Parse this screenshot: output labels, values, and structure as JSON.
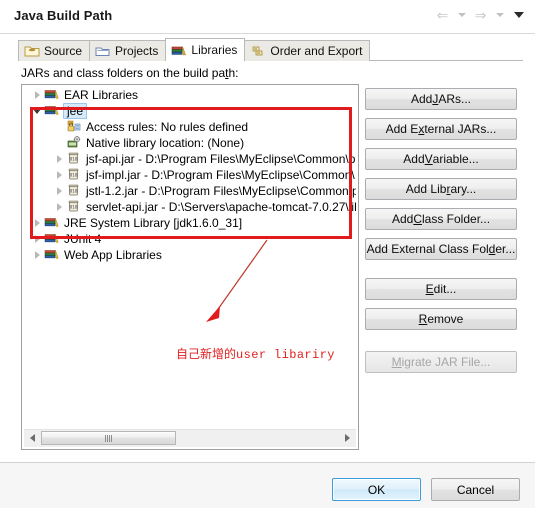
{
  "window": {
    "title": "Java Build Path",
    "nav": [
      {
        "name": "back-arrow-icon",
        "glyph": "⇐"
      },
      {
        "name": "back-dropdown-icon",
        "glyph": "▾"
      },
      {
        "name": "forward-arrow-icon",
        "glyph": "⇒"
      },
      {
        "name": "forward-dropdown-icon",
        "glyph": "▾"
      },
      {
        "name": "menu-dropdown-icon",
        "glyph": "▾"
      }
    ]
  },
  "tabs": [
    {
      "label": "Source",
      "icon": "source-folder-icon",
      "active": false
    },
    {
      "label": "Projects",
      "icon": "projects-folder-icon",
      "active": false
    },
    {
      "label": "Libraries",
      "icon": "libraries-books-icon",
      "active": true
    },
    {
      "label": "Order and Export",
      "icon": "order-export-icon",
      "active": false
    }
  ],
  "main": {
    "section_label_pre": "JARs and class folders on the build pa",
    "section_label_mnemonic": "t",
    "section_label_post": "h:",
    "tree": [
      {
        "label": "EAR Libraries",
        "icon": "library-books-icon",
        "indent": 0,
        "twisty": "closed",
        "selected": false
      },
      {
        "label": "jee",
        "icon": "library-books-icon",
        "indent": 0,
        "twisty": "open",
        "selected": true
      },
      {
        "label": "Access rules: No rules defined",
        "icon": "access-rules-icon",
        "indent": 1,
        "twisty": "none",
        "selected": false
      },
      {
        "label": "Native library location: (None)",
        "icon": "native-library-icon",
        "indent": 1,
        "twisty": "none",
        "selected": false
      },
      {
        "label": "jsf-api.jar - D:\\Program Files\\MyEclipse\\Common\\p",
        "icon": "jar-icon",
        "indent": 1,
        "twisty": "closed",
        "selected": false
      },
      {
        "label": "jsf-impl.jar - D:\\Program Files\\MyEclipse\\Common\\",
        "icon": "jar-icon",
        "indent": 1,
        "twisty": "closed",
        "selected": false
      },
      {
        "label": "jstl-1.2.jar - D:\\Program Files\\MyEclipse\\Common\\p",
        "icon": "jar-icon",
        "indent": 1,
        "twisty": "closed",
        "selected": false
      },
      {
        "label": "servlet-api.jar - D:\\Servers\\apache-tomcat-7.0.27\\lib",
        "icon": "jar-icon",
        "indent": 1,
        "twisty": "closed",
        "selected": false
      },
      {
        "label": "JRE System Library [jdk1.6.0_31]",
        "icon": "library-books-icon",
        "indent": 0,
        "twisty": "closed",
        "selected": false
      },
      {
        "label": "JUnit 4",
        "icon": "library-books-icon",
        "indent": 0,
        "twisty": "closed",
        "selected": false
      },
      {
        "label": "Web App Libraries",
        "icon": "library-books-icon",
        "indent": 0,
        "twisty": "closed",
        "selected": false
      }
    ],
    "scrollbar": {
      "left_arrow": "◀",
      "right_arrow": "▶"
    }
  },
  "buttons": [
    {
      "name": "add-jars-button",
      "pre": "Add ",
      "mn": "J",
      "post": "ARs...",
      "disabled": false
    },
    {
      "name": "add-external-jars-button",
      "pre": "Add E",
      "mn": "x",
      "post": "ternal JARs...",
      "disabled": false
    },
    {
      "name": "add-variable-button",
      "pre": "Add ",
      "mn": "V",
      "post": "ariable...",
      "disabled": false
    },
    {
      "name": "add-library-button",
      "pre": "Add Lib",
      "mn": "r",
      "post": "ary...",
      "disabled": false
    },
    {
      "name": "add-class-folder-button",
      "pre": "Add ",
      "mn": "C",
      "post": "lass Folder...",
      "disabled": false
    },
    {
      "name": "add-external-class-folder-button",
      "pre": "Add External Class Fol",
      "mn": "d",
      "post": "er...",
      "disabled": false
    },
    {
      "name": "edit-button",
      "pre": "",
      "mn": "E",
      "post": "dit...",
      "disabled": false
    },
    {
      "name": "remove-button",
      "pre": "",
      "mn": "R",
      "post": "emove",
      "disabled": false
    },
    {
      "name": "migrate-jar-file-button",
      "pre": "",
      "mn": "M",
      "post": "igrate JAR File...",
      "disabled": true
    }
  ],
  "footer": {
    "ok_label": "OK",
    "cancel_label": "Cancel"
  },
  "annotations": {
    "highlight_color": "#e11b1b",
    "note_cjk": "自己新增的",
    "note_ascii": "user libariry"
  }
}
